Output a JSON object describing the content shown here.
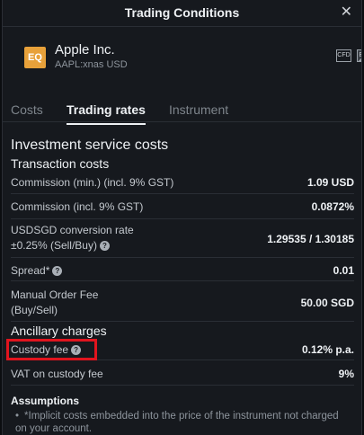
{
  "dialog": {
    "title": "Trading Conditions",
    "close_label": "✕"
  },
  "instrument": {
    "badge": "EQ",
    "name": "Apple Inc.",
    "ticker": "AAPL:xnas USD"
  },
  "toolbar": {
    "cfd_label": "CFD",
    "eq_label": "EQ",
    "search_glyph": "⌕"
  },
  "tabs": [
    {
      "label": "Costs",
      "active": false
    },
    {
      "label": "Trading rates",
      "active": true
    },
    {
      "label": "Instrument",
      "active": false
    }
  ],
  "sections": {
    "investment_title": "Investment service costs",
    "transaction_title": "Transaction costs",
    "ancillary_title": "Ancillary charges"
  },
  "rows": {
    "commission_min": {
      "label": "Commission (min.) (incl. 9% GST)",
      "value": "1.09 USD"
    },
    "commission": {
      "label": "Commission (incl. 9% GST)",
      "value": "0.0872%"
    },
    "conversion": {
      "label_line1": "USDSGD conversion rate",
      "label_line2": "±0.25% (Sell/Buy)",
      "value": "1.29535 / 1.30185"
    },
    "spread": {
      "label": "Spread*",
      "value": "0.01"
    },
    "manual_fee": {
      "label_line1": "Manual Order Fee",
      "label_line2": "(Buy/Sell)",
      "value": "50.00 SGD"
    },
    "custody": {
      "label": "Custody fee",
      "value": "0.12% p.a."
    },
    "vat": {
      "label": "VAT on custody fee",
      "value": "9%"
    }
  },
  "help_glyph": "?",
  "assumptions": {
    "title": "Assumptions",
    "bullet": "•",
    "note": "*Implicit costs embedded into the price of the instrument not charged on your account."
  },
  "colors": {
    "badge": "#e8a13a",
    "highlight": "#e0141e",
    "background": "#16191e"
  }
}
